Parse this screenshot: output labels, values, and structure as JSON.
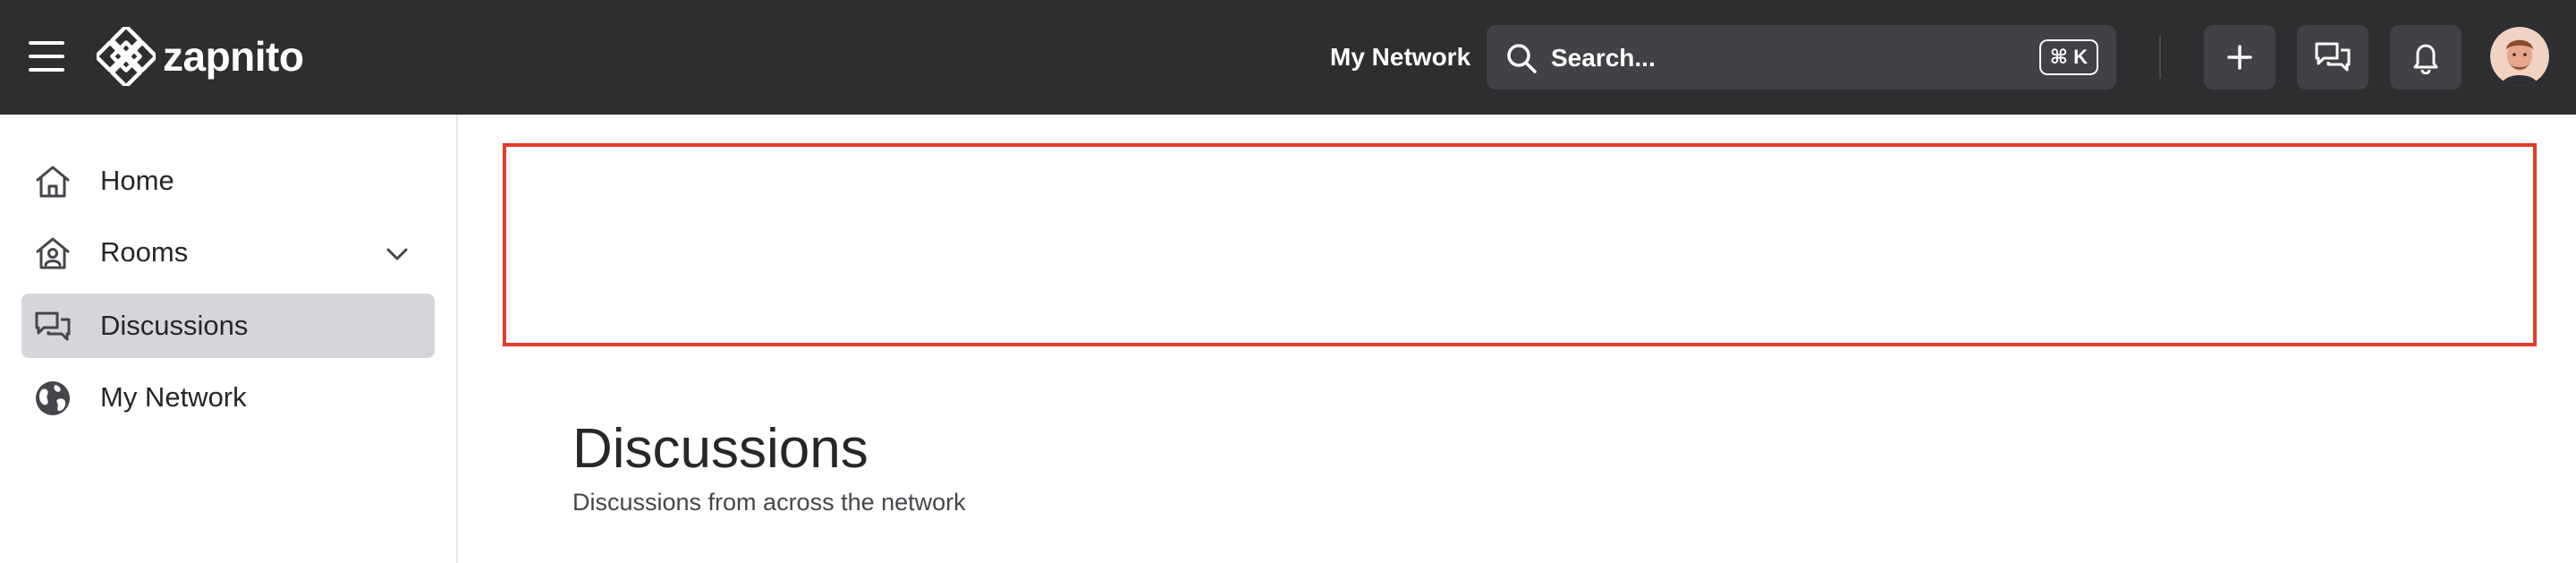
{
  "header": {
    "brand": "zapnito",
    "nav_link": "My Network",
    "search": {
      "placeholder": "Search...",
      "shortcut": "⌘ K"
    },
    "actions": [
      "plus-icon",
      "chat-bubbles-icon",
      "bell-icon"
    ],
    "colors": {
      "bar": "#2e2e31",
      "control": "#414146"
    }
  },
  "sidebar": {
    "items": [
      {
        "label": "Home",
        "icon": "home-icon",
        "active": false
      },
      {
        "label": "Rooms",
        "icon": "rooms-icon",
        "active": false,
        "expandable": true
      },
      {
        "label": "Discussions",
        "icon": "chat-bubbles-icon",
        "active": true
      },
      {
        "label": "My Network",
        "icon": "globe-icon",
        "active": false
      }
    ]
  },
  "main": {
    "banner_border_color": "#e23c2a",
    "title": "Discussions",
    "subtitle": "Discussions from across the network"
  }
}
